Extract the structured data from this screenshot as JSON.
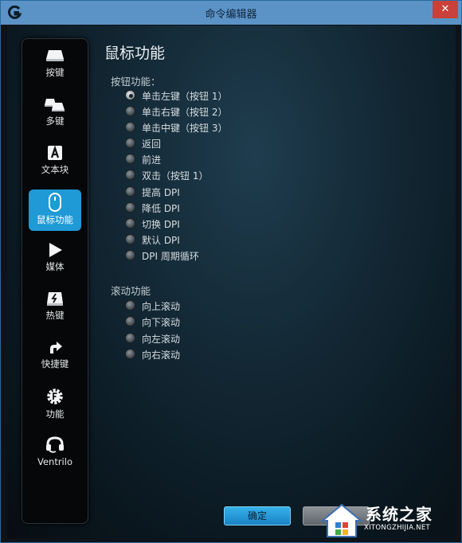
{
  "window": {
    "title": "命令编辑器",
    "close_label": "✕"
  },
  "sidebar": {
    "items": [
      {
        "label": "按键",
        "icon": "key-icon",
        "active": false
      },
      {
        "label": "多键",
        "icon": "multikey-icon",
        "active": false
      },
      {
        "label": "文本块",
        "icon": "text-block-icon",
        "active": false
      },
      {
        "label": "鼠标功能",
        "icon": "mouse-icon",
        "active": true
      },
      {
        "label": "媒体",
        "icon": "play-icon",
        "active": false
      },
      {
        "label": "热键",
        "icon": "hotkey-icon",
        "active": false
      },
      {
        "label": "快捷键",
        "icon": "shortcut-arrow-icon",
        "active": false
      },
      {
        "label": "功能",
        "icon": "function-gear-icon",
        "active": false
      },
      {
        "label": "Ventrilo",
        "icon": "headset-icon",
        "active": false
      }
    ]
  },
  "main": {
    "heading": "鼠标功能",
    "button_group": {
      "title": "按钮功能：",
      "options": [
        "单击左键（按钮 1）",
        "单击右键（按钮 2）",
        "单击中键（按钮 3）",
        "返回",
        "前进",
        "双击（按钮 1）",
        "提高 DPI",
        "降低 DPI",
        "切换 DPI",
        "默认 DPI",
        "DPI 周期循环"
      ],
      "selected_index": 0
    },
    "scroll_group": {
      "title": "滚动功能",
      "options": [
        "向上滚动",
        "向下滚动",
        "向左滚动",
        "向右滚动"
      ]
    }
  },
  "footer": {
    "ok_label": "确定"
  },
  "watermark": {
    "text": "系统之家",
    "sub": "XITONGZHIJIA.NET"
  },
  "colors": {
    "accent": "#1f9ad6",
    "titlebar": "#5b93c6",
    "close": "#c8413a"
  }
}
